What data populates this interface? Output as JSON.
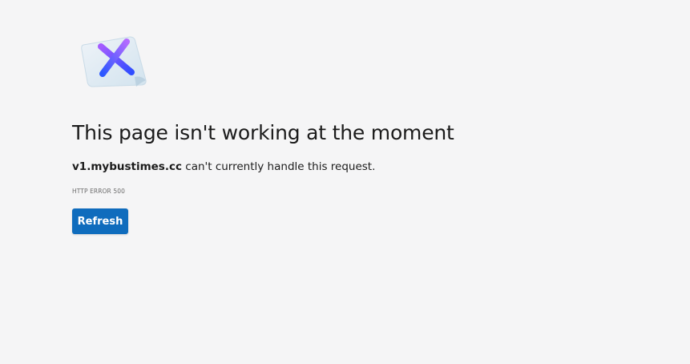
{
  "error": {
    "icon": "error-x-icon",
    "title": "This page isn't working at the moment",
    "host": "v1.mybustimes.cc",
    "message_suffix": " can't currently handle this request.",
    "code": "HTTP ERROR 500"
  },
  "actions": {
    "refresh_label": "Refresh"
  },
  "colors": {
    "background": "#f5f5f6",
    "button": "#0f6cbd",
    "icon_gradient_start": "#8a4dff",
    "icon_gradient_end": "#2f5bff"
  }
}
